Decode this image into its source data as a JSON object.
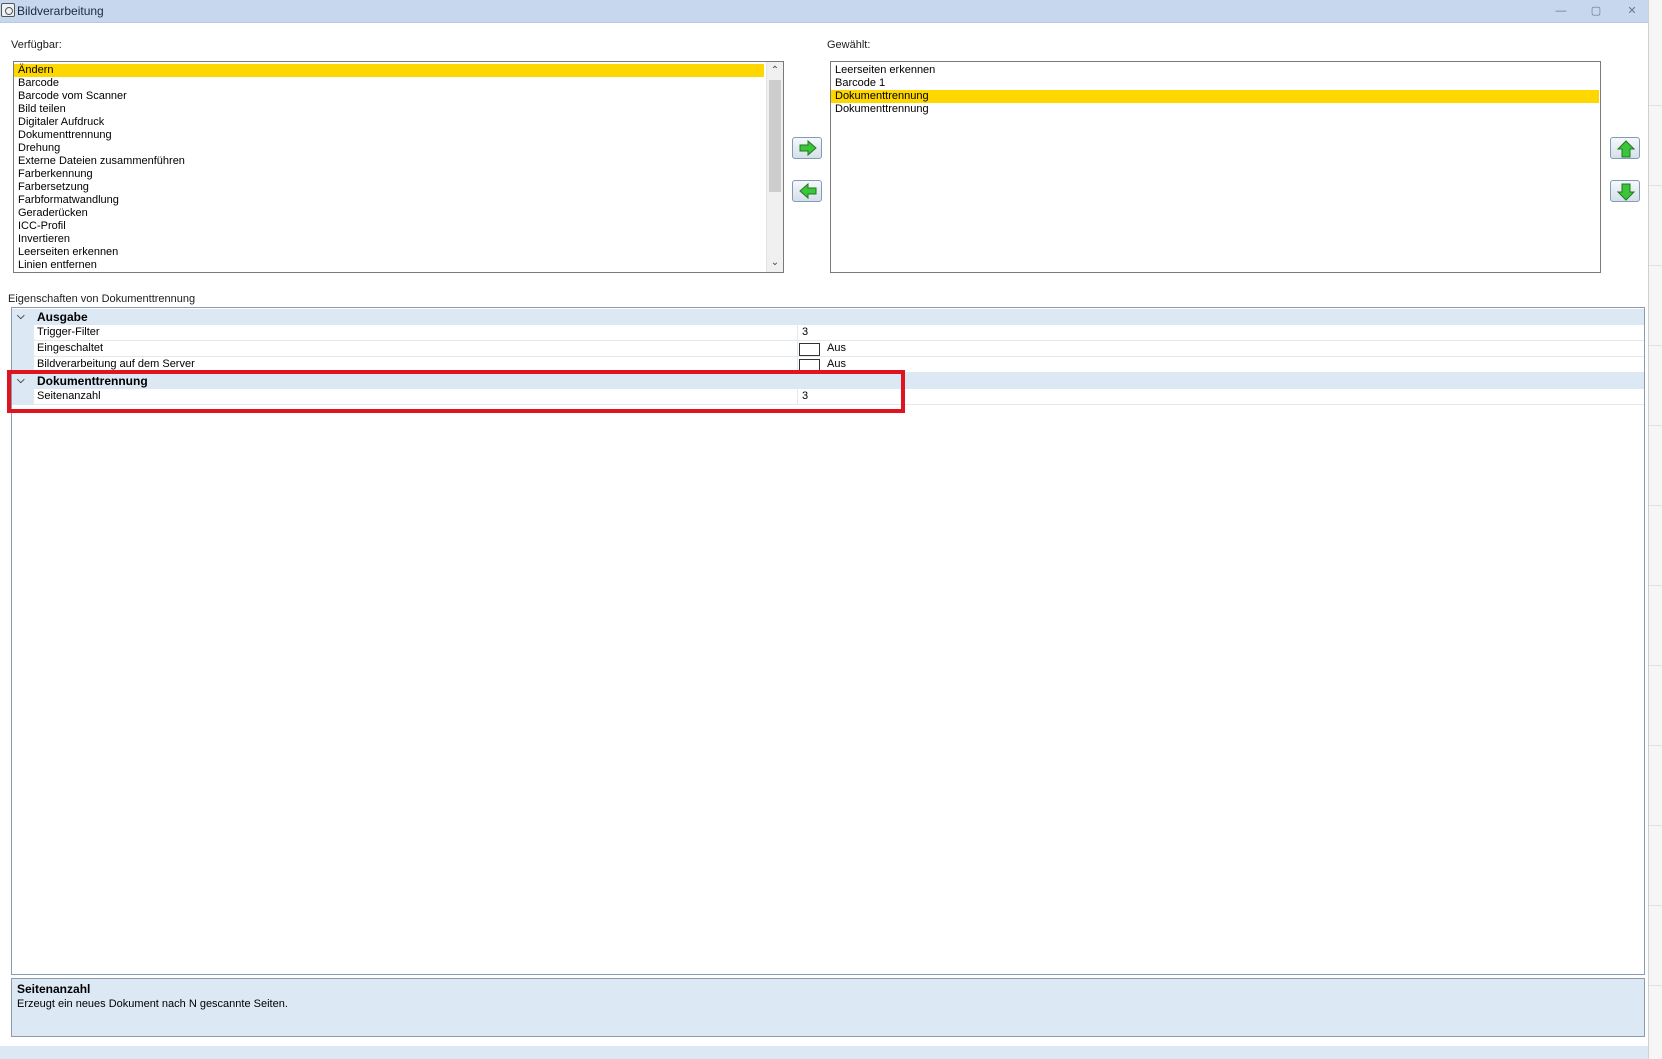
{
  "window": {
    "title": "Bildverarbeitung",
    "minimize_label": "—",
    "maximize_label": "▢",
    "close_label": "✕"
  },
  "available": {
    "label": "Verfügbar:",
    "items": [
      {
        "label": "Ändern",
        "selected": true
      },
      {
        "label": "Barcode",
        "selected": false
      },
      {
        "label": "Barcode vom Scanner",
        "selected": false
      },
      {
        "label": "Bild teilen",
        "selected": false
      },
      {
        "label": "Digitaler Aufdruck",
        "selected": false
      },
      {
        "label": "Dokumenttrennung",
        "selected": false
      },
      {
        "label": "Drehung",
        "selected": false
      },
      {
        "label": "Externe Dateien zusammenführen",
        "selected": false
      },
      {
        "label": "Farberkennung",
        "selected": false
      },
      {
        "label": "Farbersetzung",
        "selected": false
      },
      {
        "label": "Farbformatwandlung",
        "selected": false
      },
      {
        "label": "Geraderücken",
        "selected": false
      },
      {
        "label": "ICC-Profil",
        "selected": false
      },
      {
        "label": "Invertieren",
        "selected": false
      },
      {
        "label": "Leerseiten erkennen",
        "selected": false
      },
      {
        "label": "Linien entfernen",
        "selected": false
      }
    ]
  },
  "selected": {
    "label": "Gewählt:",
    "items": [
      {
        "label": "Leerseiten erkennen",
        "selected": false
      },
      {
        "label": "Barcode 1",
        "selected": false
      },
      {
        "label": "Dokumenttrennung",
        "selected": true
      },
      {
        "label": "Dokumenttrennung",
        "selected": false
      }
    ]
  },
  "properties": {
    "label": "Eigenschaften von Dokumenttrennung",
    "categories": [
      {
        "name": "Ausgabe",
        "rows": [
          {
            "name": "Trigger-Filter",
            "value": "3",
            "type": "text"
          },
          {
            "name": "Eingeschaltet",
            "value": "Aus",
            "type": "checkbox"
          },
          {
            "name": "Bildverarbeitung auf dem Server",
            "value": "Aus",
            "type": "checkbox"
          }
        ]
      },
      {
        "name": "Dokumenttrennung",
        "rows": [
          {
            "name": "Seitenanzahl",
            "value": "3",
            "type": "text"
          }
        ]
      }
    ]
  },
  "description": {
    "title": "Seitenanzahl",
    "text": "Erzeugt ein neues Dokument nach N gescannte Seiten."
  },
  "colors": {
    "selection": "#ffd700",
    "highlight_border": "#e0141e",
    "arrow_green": "#3cc43c",
    "category_bg": "#dde8f5"
  },
  "icons": {
    "add": "arrow-right-icon",
    "remove": "arrow-left-icon",
    "move_up": "arrow-up-icon",
    "move_down": "arrow-down-icon"
  }
}
